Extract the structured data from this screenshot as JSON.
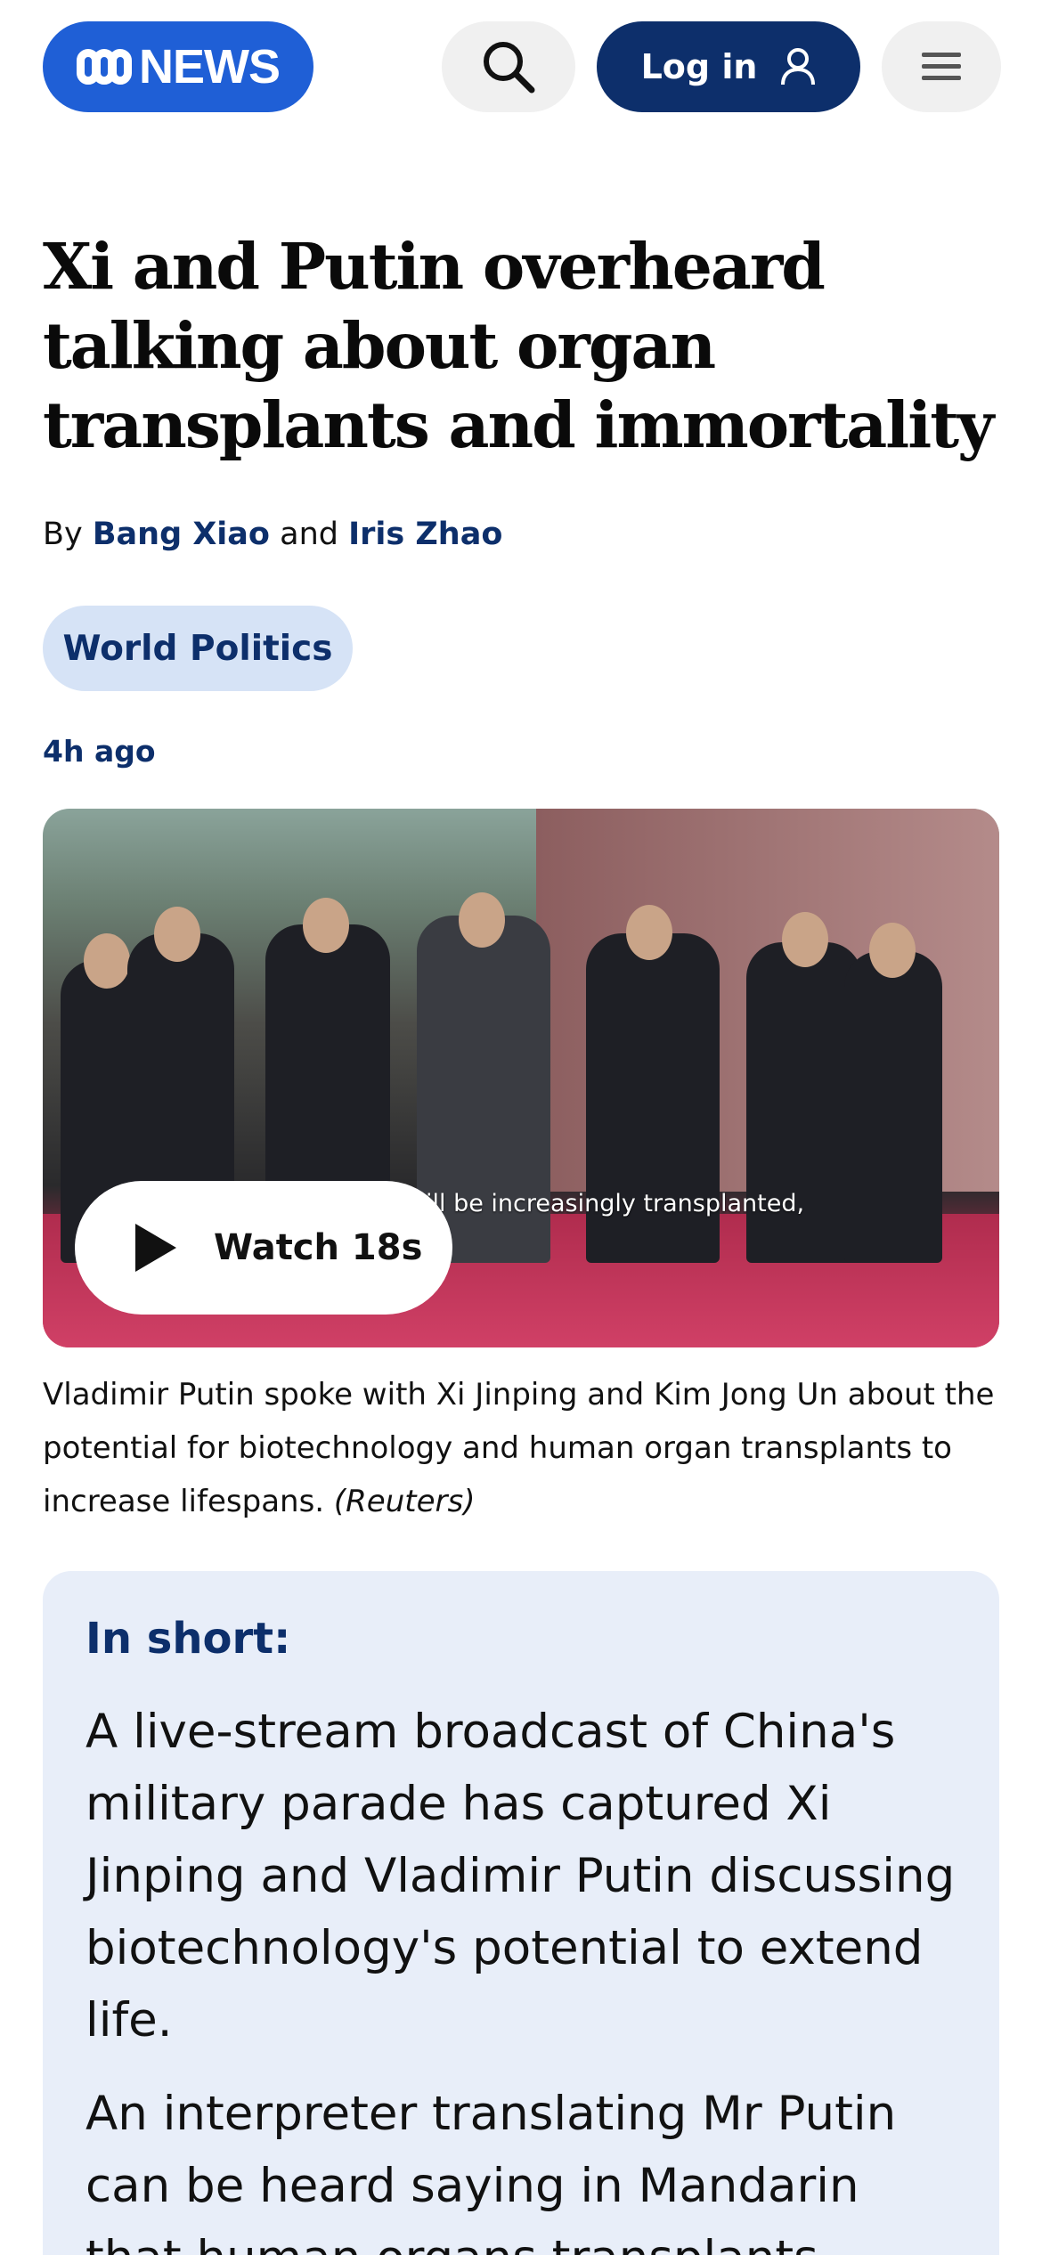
{
  "header": {
    "logo_text": "NEWS",
    "login_label": "Log in",
    "icons": [
      "search-icon",
      "user-icon",
      "menu-icon"
    ]
  },
  "article": {
    "headline": "Xi and Putin overheard talking about organ transplants and immortality",
    "byline": {
      "prefix": "By",
      "author1": "Bang Xiao",
      "conjunction": "and",
      "author2": "Iris Zhao"
    },
    "tag": "World Politics",
    "timestamp": "4h ago",
    "video": {
      "subtitle_overlay": "ill be increasingly transplanted,",
      "watch_label": "Watch 18s"
    },
    "caption": {
      "text": "Vladimir Putin spoke with Xi Jinping and Kim Jong Un about the potential for biotechnology and human organ transplants to increase lifespans.",
      "credit": "(Reuters)"
    },
    "in_short": {
      "title": "In short:",
      "paragraphs": [
        "A live-stream broadcast of China's military parade has captured Xi Jinping and Vladimir Putin discussing biotechnology's potential to extend life.",
        "An interpreter translating Mr Putin can be heard saying in Mandarin that human organs transplants could let"
      ]
    }
  },
  "colors": {
    "brand_blue": "#1f5fd6",
    "navy": "#0d2f6b",
    "tag_bg": "#d6e3f6",
    "short_bg": "#e8eef9"
  }
}
